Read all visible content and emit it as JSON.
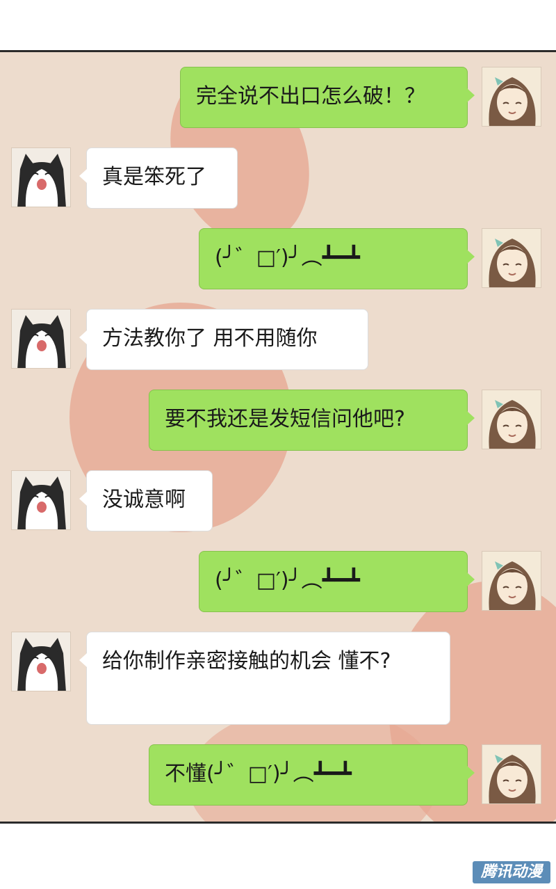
{
  "messages": [
    {
      "side": "right",
      "sender": "girl",
      "text": "完全说不出口怎么破！？"
    },
    {
      "side": "left",
      "sender": "cat",
      "text": "真是笨死了"
    },
    {
      "side": "right",
      "sender": "girl",
      "text": "(╯゛□′)╯︵┻━┻"
    },
    {
      "side": "left",
      "sender": "cat",
      "text": "方法教你了 用不用随你"
    },
    {
      "side": "right",
      "sender": "girl",
      "text": "要不我还是发短信问他吧?"
    },
    {
      "side": "left",
      "sender": "cat",
      "text": "没诚意啊"
    },
    {
      "side": "right",
      "sender": "girl",
      "text": "(╯゛□′)╯︵┻━┻"
    },
    {
      "side": "left",
      "sender": "cat",
      "text": "给你制作亲密接触的机会 懂不?"
    },
    {
      "side": "right",
      "sender": "girl",
      "text": "不懂(╯゛□′)╯︵┻━┻"
    }
  ],
  "avatars": {
    "girl": "girl-avatar-icon",
    "cat": "cat-avatar-icon"
  },
  "colors": {
    "background": "#eddccd",
    "my_bubble": "#9fe15f",
    "other_bubble": "#ffffff",
    "blob": "#e6a58f"
  },
  "watermark": "腾讯动漫"
}
